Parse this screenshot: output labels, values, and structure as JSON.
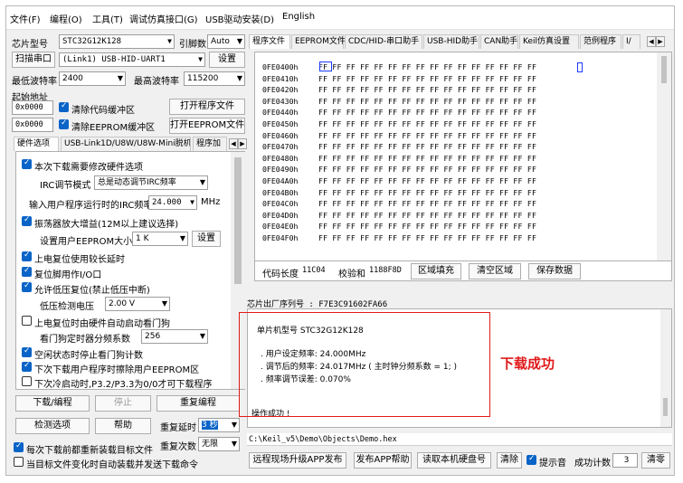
{
  "menu": [
    "文件(F)",
    "编程(O)",
    "工具(T)",
    "调试仿真接口(G)",
    "USB驱动安装(D)",
    "English"
  ],
  "left": {
    "chip_model_label": "芯片型号",
    "chip_model_value": "STC32G12K128",
    "pin_count_label": "引脚数",
    "pin_count_value": "Auto",
    "scan_port_button": "扫描串口",
    "port_value": "(Link1) USB-HID-UART1",
    "settings_button": "设置",
    "min_baud_label": "最低波特率",
    "min_baud_value": "2400",
    "max_baud_label": "最高波特率",
    "max_baud_value": "115200",
    "start_addr_label": "起始地址",
    "addr1_value": "0x0000",
    "clear_code_label": "清除代码缓冲区",
    "open_prog_button": "打开程序文件",
    "addr2_value": "0x0000",
    "clear_eeprom_label": "清除EEPROM缓冲区",
    "open_eeprom_button": "打开EEPROM文件",
    "tabs": [
      "硬件选项",
      "USB-Link1D/U8W/U8W-Mini脱机",
      "程序加"
    ],
    "options": {
      "opt1": "本次下载需要修改硬件选项",
      "irc_mode_label": "IRC调节模式",
      "irc_mode_value": "总是动态调节IRC频率",
      "freq_label": "输入用户程序运行时的IRC频率",
      "freq_value": "24.000",
      "freq_unit": "MHz",
      "opt2": "振荡器放大增益(12M以上建议选择)",
      "eeprom_label": "设置用户EEPROM大小",
      "eeprom_value": "1 K",
      "eeprom_btn": "设置",
      "opt3": "上电复位使用较长延时",
      "opt4": "复位脚用作I/O口",
      "opt5": "允许低压复位(禁止低压中断)",
      "lvd_label": "低压检测电压",
      "lvd_value": "2.00 V",
      "opt6": "上电复位时由硬件自动启动看门狗",
      "wdt_label": "看门狗定时器分频系数",
      "wdt_value": "256",
      "opt7": "空闲状态时停止看门狗计数",
      "opt8": "下次下载用户程序时擦除用户EEPROM区",
      "opt9": "下次冷启动时,P3.2/P3.3为0/0才可下载程序"
    },
    "download_button": "下载/编程",
    "stop_button": "停止",
    "reprogram_button": "重复编程",
    "detect_button": "检测选项",
    "help_button": "帮助",
    "repeat_delay_label": "重复延时",
    "repeat_delay_value": "3 秒",
    "repeat_count_label": "重复次数",
    "repeat_count_value": "无限",
    "reload_label": "每次下载前都重新装载目标文件",
    "auto_label": "当目标文件变化时自动装载并发送下载命令"
  },
  "right": {
    "tabs": [
      "程序文件",
      "EEPROM文件",
      "CDC/HID-串口助手",
      "USB-HID助手",
      "CAN助手",
      "Keil仿真设置",
      "范例程序",
      "I/"
    ],
    "hex_rows": [
      {
        "addr": "0FE0400h",
        "data": "FF FF FF FF FF FF FF FF FF FF FF FF FF FF FF FF"
      },
      {
        "addr": "0FE0410h",
        "data": "FF FF FF FF FF FF FF FF FF FF FF FF FF FF FF FF"
      },
      {
        "addr": "0FE0420h",
        "data": "FF FF FF FF FF FF FF FF FF FF FF FF FF FF FF FF"
      },
      {
        "addr": "0FE0430h",
        "data": "FF FF FF FF FF FF FF FF FF FF FF FF FF FF FF FF"
      },
      {
        "addr": "0FE0440h",
        "data": "FF FF FF FF FF FF FF FF FF FF FF FF FF FF FF FF"
      },
      {
        "addr": "0FE0450h",
        "data": "FF FF FF FF FF FF FF FF FF FF FF FF FF FF FF FF"
      },
      {
        "addr": "0FE0460h",
        "data": "FF FF FF FF FF FF FF FF FF FF FF FF FF FF FF FF"
      },
      {
        "addr": "0FE0470h",
        "data": "FF FF FF FF FF FF FF FF FF FF FF FF FF FF FF FF"
      },
      {
        "addr": "0FE0480h",
        "data": "FF FF FF FF FF FF FF FF FF FF FF FF FF FF FF FF"
      },
      {
        "addr": "0FE0490h",
        "data": "FF FF FF FF FF FF FF FF FF FF FF FF FF FF FF FF"
      },
      {
        "addr": "0FE04A0h",
        "data": "FF FF FF FF FF FF FF FF FF FF FF FF FF FF FF FF"
      },
      {
        "addr": "0FE04B0h",
        "data": "FF FF FF FF FF FF FF FF FF FF FF FF FF FF FF FF"
      },
      {
        "addr": "0FE04C0h",
        "data": "FF FF FF FF FF FF FF FF FF FF FF FF FF FF FF FF"
      },
      {
        "addr": "0FE04D0h",
        "data": "FF FF FF FF FF FF FF FF FF FF FF FF FF FF FF FF"
      },
      {
        "addr": "0FE04E0h",
        "data": "FF FF FF FF FF FF FF FF FF FF FF FF FF FF FF FF"
      },
      {
        "addr": "0FE04F0h",
        "data": "FF FF FF FF FF FF FF FF FF FF FF FF FF FF FF FF"
      }
    ],
    "code_len_label": "代码长度",
    "code_len_value": "11C04",
    "checksum_label": "校验和",
    "checksum_value": "1188F8D",
    "fill_button": "区域填充",
    "clear_button": "清空区域",
    "save_button": "保存数据",
    "serial_line": "芯片出厂序列号 : F7E3C91602FA66",
    "log": {
      "model": "单片机型号   STC32G12K128",
      "line1": ". 用户设定频率: 24.000MHz",
      "line2": ". 调节后的频率: 24.017MHz ( 主时钟分频系数 = 1; )",
      "line3": ". 频率调节误差: 0.070%",
      "status": "操作成功 !"
    },
    "annotation": "下载成功",
    "path_value": "C:\\Keil_v5\\Demo\\Objects\\Demo.hex",
    "remote_button": "远程现场升级APP发布",
    "publish_button": "发布APP帮助",
    "read_disk_button": "读取本机硬盘号",
    "clear_log_button": "清除",
    "sound_label": "提示音",
    "success_count_label": "成功计数",
    "success_count_value": "3",
    "reset_button": "清零"
  },
  "colors": {
    "accent": "#0a64c8",
    "annotation": "#e01a1a"
  }
}
